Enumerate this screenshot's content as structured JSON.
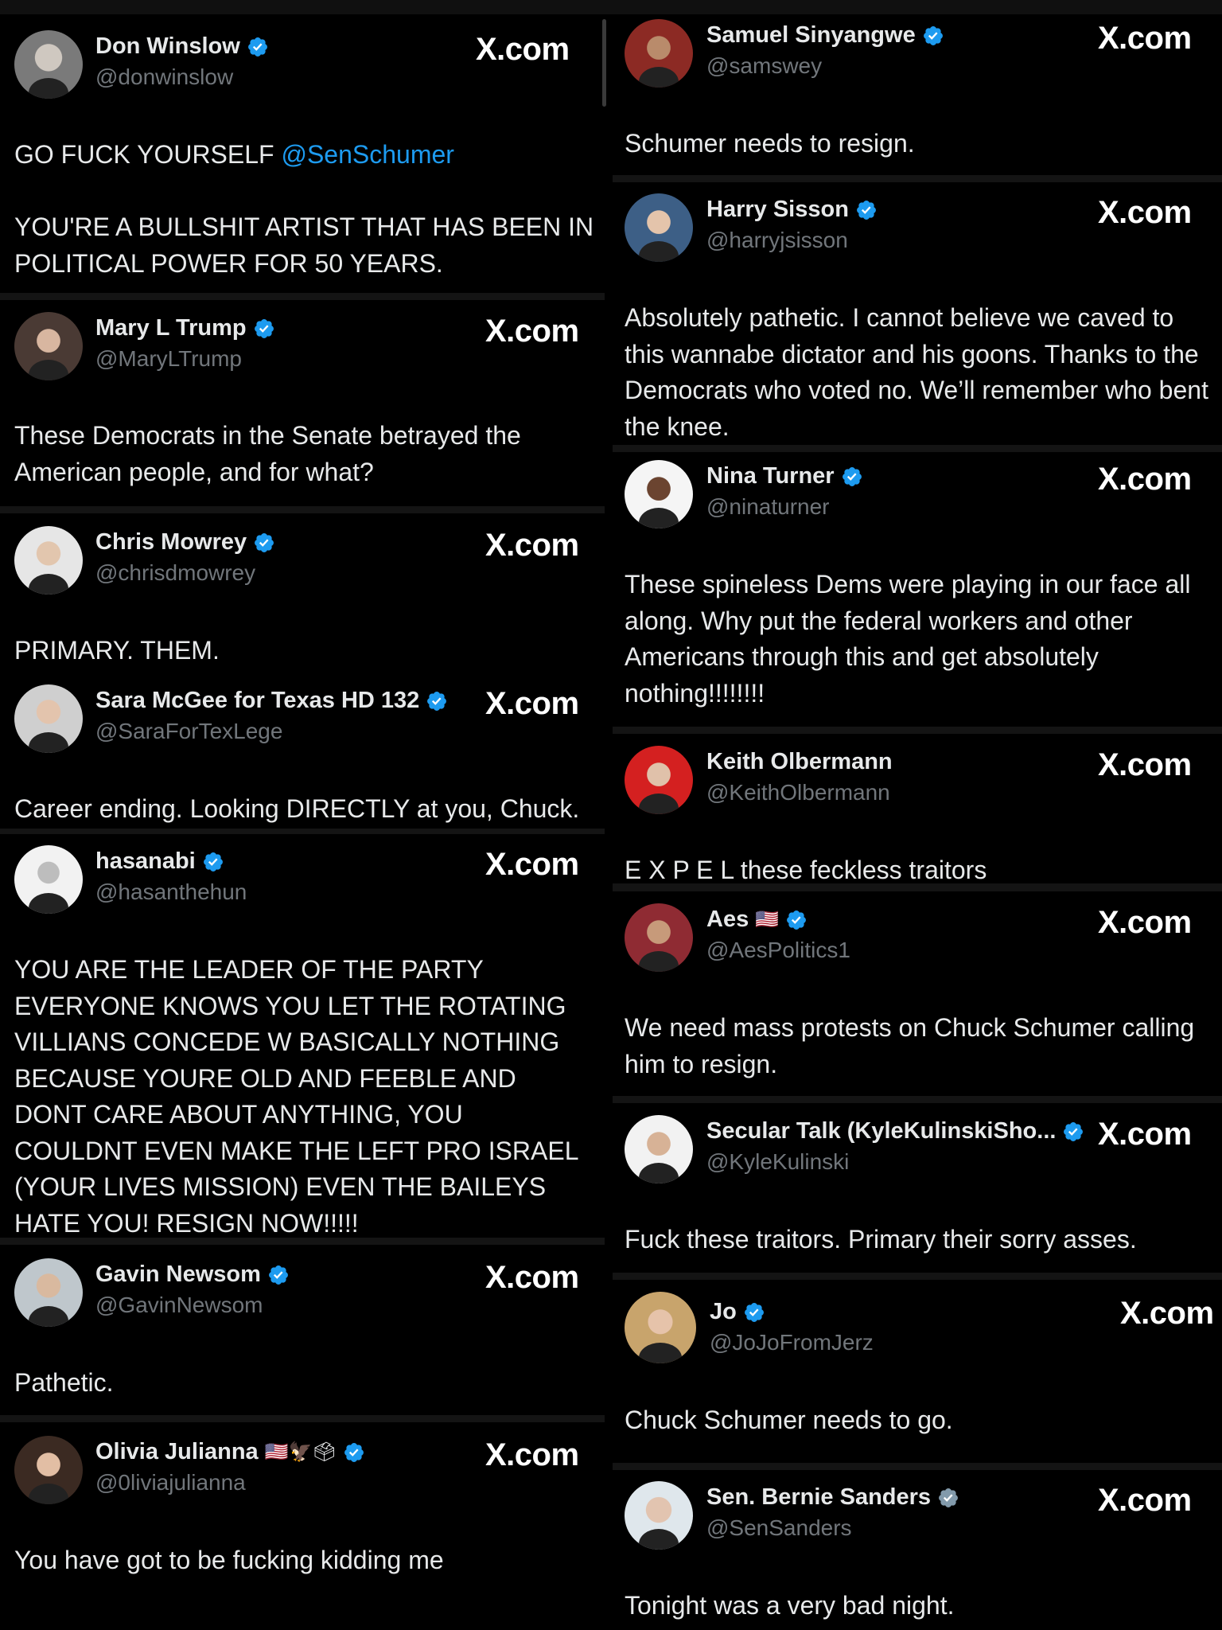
{
  "brand": {
    "verified_color": "#1d9bf0",
    "gray_verified_color": "#829aab",
    "link_color": "#1d9bf0"
  },
  "left": [
    {
      "name": "Don Winslow",
      "handle": "@donwinslow",
      "site": "X.com",
      "text_parts": [
        "GO FUCK YOURSELF ",
        "@SenSchumer",
        "\n\nYOU'RE A BULLSHIT ARTIST THAT HAS BEEN IN POLITICAL POWER FOR 50 YEARS."
      ]
    },
    {
      "name": "Mary L Trump",
      "handle": "@MaryLTrump",
      "site": "X.com",
      "text": "These Democrats in the Senate betrayed the American people, and for what?"
    },
    {
      "name": "Chris Mowrey",
      "handle": "@chrisdmowrey",
      "site": "X.com",
      "text": "PRIMARY. THEM."
    },
    {
      "name": "Sara McGee for Texas HD 132",
      "handle": "@SaraForTexLege",
      "site": "X.com",
      "text": "Career ending. Looking DIRECTLY at you, Chuck."
    },
    {
      "name": "hasanabi",
      "handle": "@hasanthehun",
      "site": "X.com",
      "text": "YOU ARE THE LEADER OF THE PARTY EVERYONE KNOWS YOU LET THE ROTATING VILLIANS CONCEDE W BASICALLY NOTHING BECAUSE YOURE OLD AND FEEBLE AND DONT CARE ABOUT ANYTHING, YOU COULDNT EVEN MAKE THE LEFT PRO ISRAEL (YOUR LIVES MISSION) EVEN THE BAILEYS HATE YOU! RESIGN NOW!!!!!"
    },
    {
      "name": "Gavin Newsom",
      "handle": "@GavinNewsom",
      "site": "X.com",
      "text": "Pathetic."
    },
    {
      "name": "Olivia Julianna",
      "name_emoji": "🇺🇸🦅🗳",
      "handle": "@0liviajulianna",
      "site": "X.com",
      "text": "You have got to be fucking kidding me"
    }
  ],
  "right": [
    {
      "name": "Samuel Sinyangwe",
      "handle": "@samswey",
      "site": "X.com",
      "text": "Schumer needs to resign."
    },
    {
      "name": "Harry Sisson",
      "handle": "@harryjsisson",
      "site": "X.com",
      "text": "Absolutely pathetic. I cannot believe we caved to this wannabe dictator and his goons. Thanks to the Democrats who voted no. We’ll remember who bent the knee."
    },
    {
      "name": "Nina Turner",
      "handle": "@ninaturner",
      "site": "X.com",
      "text": "These spineless Dems were playing in our face all along. Why put the federal workers and other Americans through this and get absolutely nothing!!!!!!!!"
    },
    {
      "name": "Keith Olbermann",
      "handle": "@KeithOlbermann",
      "site": "X.com",
      "text": "E X P E L these feckless traitors"
    },
    {
      "name": "Aes",
      "name_emoji": "🇺🇸",
      "handle": "@AesPolitics1",
      "site": "X.com",
      "text": "We need mass protests on Chuck Schumer calling him to resign."
    },
    {
      "name": "Secular Talk (KyleKulinskiSho...",
      "handle": "@KyleKulinski",
      "site": "X.com",
      "text": "Fuck these traitors. Primary their sorry asses."
    },
    {
      "name": "Jo",
      "handle": "@JoJoFromJerz",
      "site": "X.com",
      "text": "Chuck Schumer needs to go."
    },
    {
      "name": "Sen. Bernie Sanders",
      "handle": "@SenSanders",
      "site": "X.com",
      "text": "Tonight was a very bad night."
    }
  ]
}
